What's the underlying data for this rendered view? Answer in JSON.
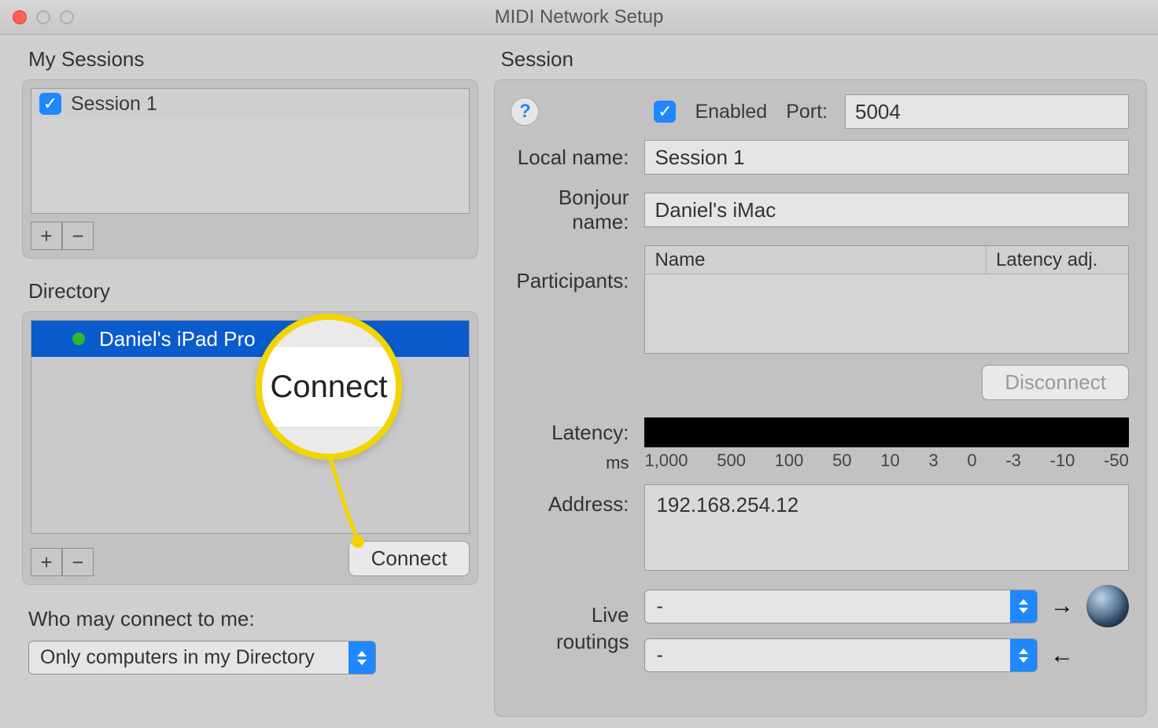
{
  "window": {
    "title": "MIDI Network Setup"
  },
  "left": {
    "sessions_label": "My Sessions",
    "session_item": "Session 1",
    "directory_label": "Directory",
    "directory_item": "Daniel's iPad Pro",
    "connect_label": "Connect",
    "who_label": "Who may connect to me:",
    "who_value": "Only computers in my Directory",
    "plus": "+",
    "minus": "−"
  },
  "callout": {
    "text": "Connect"
  },
  "right": {
    "section_label": "Session",
    "enabled_label": "Enabled",
    "port_label": "Port:",
    "port_value": "5004",
    "local_name_label": "Local name:",
    "local_name_value": "Session 1",
    "bonjour_label": "Bonjour name:",
    "bonjour_value": "Daniel's iMac",
    "participants_label": "Participants:",
    "p_name_header": "Name",
    "p_lat_header": "Latency adj.",
    "disconnect_label": "Disconnect",
    "latency_label": "Latency:",
    "ms_label": "ms",
    "ticks": [
      "1,000",
      "500",
      "100",
      "50",
      "10",
      "3",
      "0",
      "-3",
      "-10",
      "-50"
    ],
    "address_label": "Address:",
    "address_value": "192.168.254.12",
    "live_label_1": "Live",
    "live_label_2": "routings",
    "route_value": "-",
    "help": "?"
  }
}
